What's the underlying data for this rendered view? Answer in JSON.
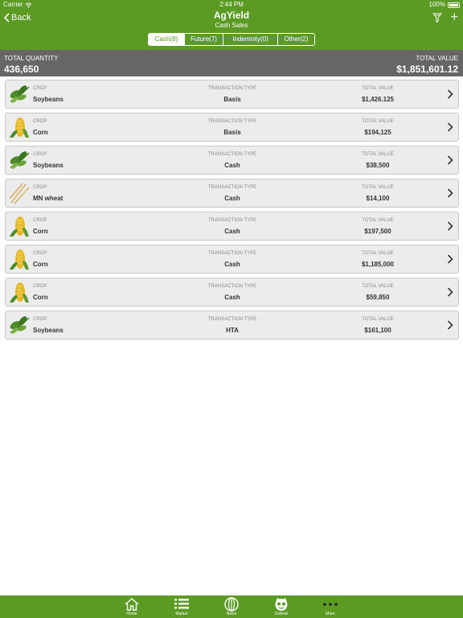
{
  "status": {
    "carrier": "Carrier",
    "time": "2:44 PM",
    "battery": "100%"
  },
  "header": {
    "back_label": "Back",
    "title": "AgYield",
    "subtitle": "Cash Sales",
    "tabs": [
      {
        "label": "Cash(8)",
        "active": true
      },
      {
        "label": "Future(7)",
        "active": false
      },
      {
        "label": "Indemnity(0)",
        "active": false
      },
      {
        "label": "Other(2)",
        "active": false
      }
    ]
  },
  "totals": {
    "quantity_label": "TOTAL QUANTITY",
    "quantity_value": "436,650",
    "value_label": "TOTAL VALUE",
    "value_value": "$1,851,601.12"
  },
  "labels": {
    "crop": "CROP",
    "transaction_type": "TRANSACTION TYPE",
    "total_value": "TOTAL VALUE"
  },
  "rows": [
    {
      "crop": "Soybeans",
      "type": "Basis",
      "value": "$1,426.125",
      "icon": "soybean-icon"
    },
    {
      "crop": "Corn",
      "type": "Basis",
      "value": "$194,125",
      "icon": "corn-icon"
    },
    {
      "crop": "Soybeans",
      "type": "Cash",
      "value": "$38,500",
      "icon": "soybean-icon"
    },
    {
      "crop": "MN wheat",
      "type": "Cash",
      "value": "$14,100",
      "icon": "wheat-icon"
    },
    {
      "crop": "Corn",
      "type": "Cash",
      "value": "$197,500",
      "icon": "corn-icon"
    },
    {
      "crop": "Corn",
      "type": "Cash",
      "value": "$1,185,000",
      "icon": "corn-icon"
    },
    {
      "crop": "Corn",
      "type": "Cash",
      "value": "$59,850",
      "icon": "corn-icon"
    },
    {
      "crop": "Soybeans",
      "type": "HTA",
      "value": "$161,100",
      "icon": "soybean-icon"
    }
  ],
  "tabbar": [
    {
      "label": "Home",
      "icon": "home-icon"
    },
    {
      "label": "Market",
      "icon": "list-icon"
    },
    {
      "label": "News",
      "icon": "globe-icon"
    },
    {
      "label": "Outlook",
      "icon": "outlook-icon"
    },
    {
      "label": "More",
      "icon": "more-dots-icon"
    }
  ],
  "colors": {
    "brand_green": "#5b9a23",
    "totals_gray": "#666666",
    "row_bg": "#ececec"
  }
}
